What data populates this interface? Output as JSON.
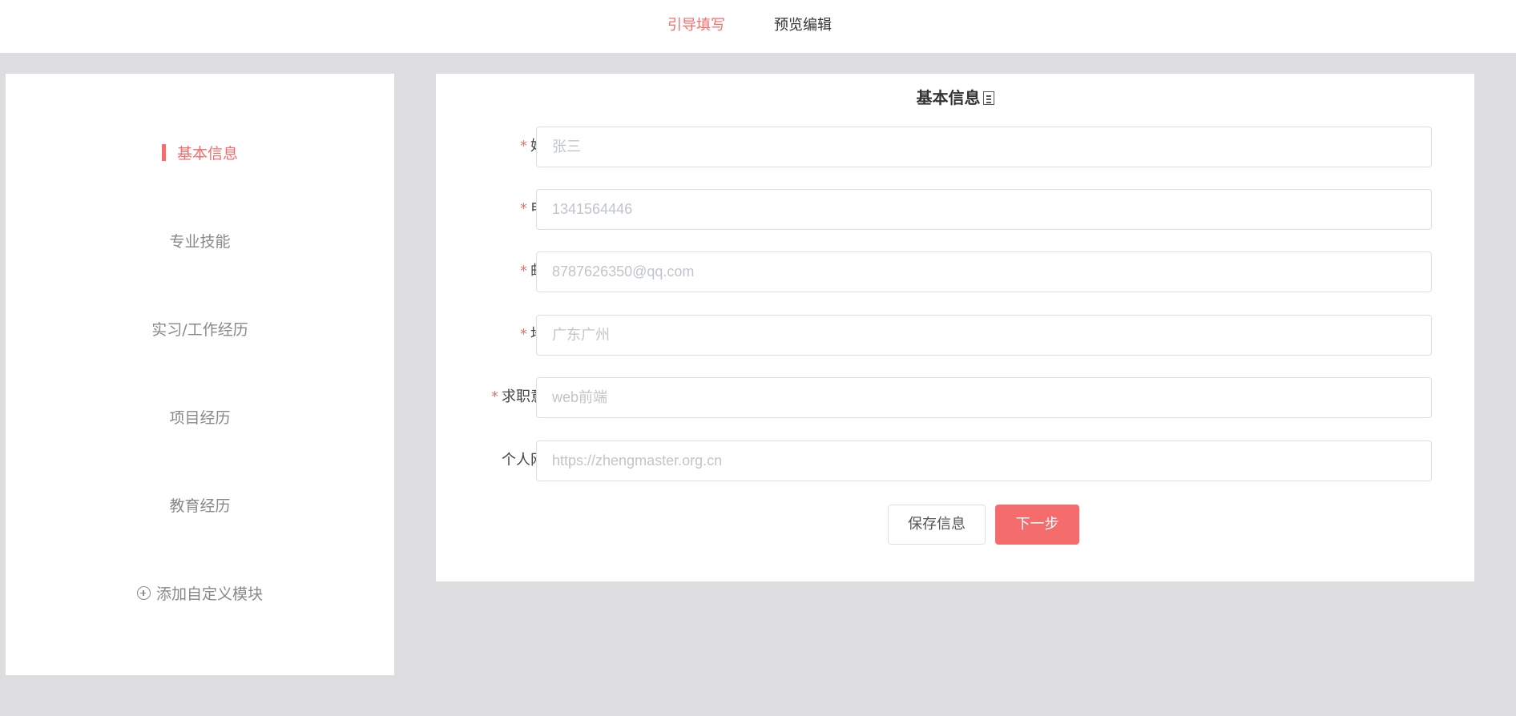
{
  "colors": {
    "accent": "#f56c6c",
    "background": "#dddddf",
    "panel": "#ffffff"
  },
  "topbar": {
    "tabs": [
      {
        "label": "引导填写",
        "active": true
      },
      {
        "label": "预览编辑",
        "active": false
      }
    ]
  },
  "sidebar": {
    "items": [
      {
        "label": "基本信息",
        "active": true
      },
      {
        "label": "专业技能",
        "active": false
      },
      {
        "label": "实习/工作经历",
        "active": false
      },
      {
        "label": "项目经历",
        "active": false
      },
      {
        "label": "教育经历",
        "active": false
      }
    ],
    "add_module": {
      "label": "添加自定义模块",
      "icon": "plus-circle-icon"
    }
  },
  "main": {
    "title": "基本信息",
    "title_icon": "document-icon",
    "fields": [
      {
        "label": "姓名",
        "required": "*",
        "value": "",
        "placeholder": "张三"
      },
      {
        "label": "电话",
        "required": "*",
        "value": "",
        "placeholder": "1341564446"
      },
      {
        "label": "邮箱",
        "required": "*",
        "value": "",
        "placeholder": "8787626350@qq.com"
      },
      {
        "label": "地址",
        "required": "*",
        "value": "",
        "placeholder": "广东广州"
      },
      {
        "label": "求职意志",
        "required": "*",
        "value": "",
        "placeholder": "web前端"
      },
      {
        "label": "个人网站",
        "required": "",
        "value": "",
        "placeholder": "https://zhengmaster.org.cn"
      }
    ],
    "buttons": {
      "save": "保存信息",
      "next": "下一步"
    }
  }
}
